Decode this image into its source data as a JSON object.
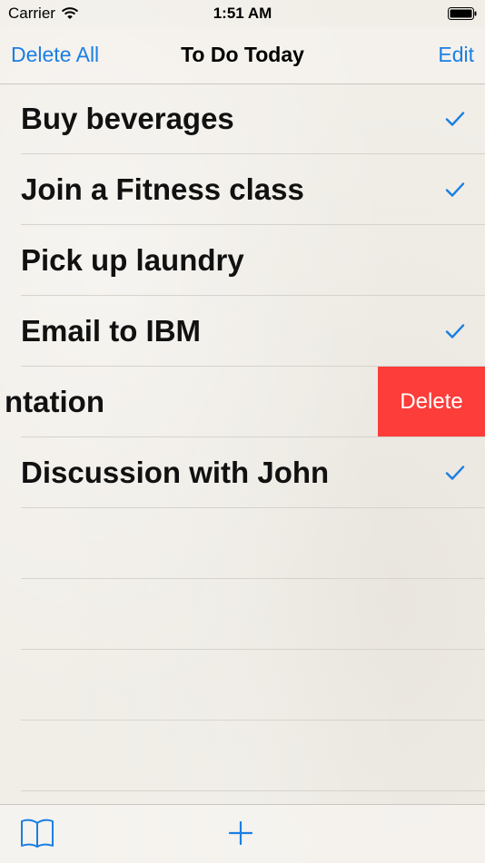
{
  "status_bar": {
    "carrier": "Carrier",
    "time": "1:51 AM"
  },
  "nav": {
    "left_label": "Delete All",
    "title": "To Do Today",
    "right_label": "Edit"
  },
  "tasks": [
    {
      "title": "Buy beverages",
      "checked": true
    },
    {
      "title": "Join a Fitness class",
      "checked": true
    },
    {
      "title": "Pick up laundry",
      "checked": false
    },
    {
      "title": "Email to IBM",
      "checked": true
    },
    {
      "title": "ntation",
      "checked": false,
      "swiped": true,
      "action_label": "Delete"
    },
    {
      "title": "Discussion with John",
      "checked": true
    }
  ],
  "tab_bar": {
    "left_icon": "book-icon",
    "center_icon": "add-icon"
  },
  "colors": {
    "accent": "#1a7fe3",
    "delete": "#fc3d39"
  }
}
